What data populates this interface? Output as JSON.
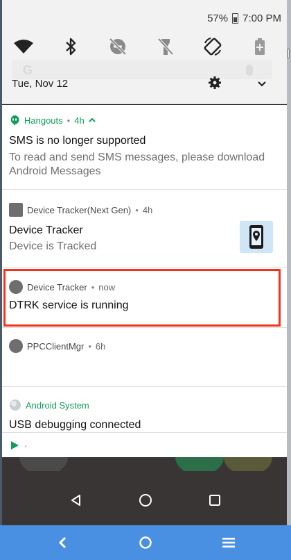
{
  "status_bar": {
    "battery_percent": "57%",
    "time": "7:00 PM"
  },
  "quick_settings": {
    "date": "Tue, Nov 12",
    "icons": [
      "wifi-icon",
      "bluetooth-icon",
      "dnd-off-icon",
      "flashlight-off-icon",
      "auto-rotate-icon",
      "battery-saver-icon"
    ]
  },
  "notifications": [
    {
      "app": "Hangouts",
      "time": "4h",
      "title": "SMS is no longer supported",
      "body": "To read and send SMS messages, please download Android Messages",
      "accent": "#0f9d58"
    },
    {
      "app": "Device Tracker(Next Gen)",
      "time": "4h",
      "title": "Device Tracker",
      "body": "Device is Tracked"
    },
    {
      "app": "Device Tracker",
      "time": "now",
      "title": "DTRK service is running"
    },
    {
      "app": "PPCClientMgr",
      "time": "6h"
    },
    {
      "app": "Android System",
      "title": "USB debugging connected",
      "accent": "#0f9d58"
    },
    {
      "app": "·"
    }
  ],
  "separator": "•",
  "colors": {
    "highlight": "#f4321d",
    "bottom_bar": "#4a90e2"
  }
}
